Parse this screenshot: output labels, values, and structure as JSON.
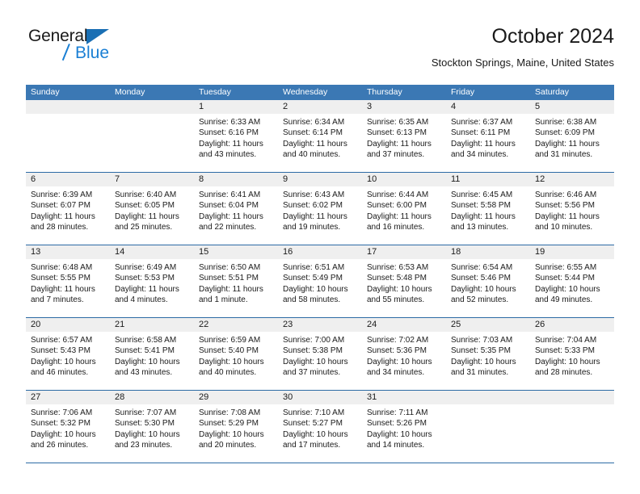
{
  "brand": {
    "name_part1": "General",
    "name_part2": "Blue"
  },
  "header": {
    "month_title": "October 2024",
    "location": "Stockton Springs, Maine, United States"
  },
  "colors": {
    "header_blue": "#3b78b4",
    "row_divider_blue": "#2c6ba5",
    "day_band_gray": "#efefef",
    "brand_blue": "#1a7fd4"
  },
  "weekdays": [
    "Sunday",
    "Monday",
    "Tuesday",
    "Wednesday",
    "Thursday",
    "Friday",
    "Saturday"
  ],
  "weeks": [
    [
      {
        "day": "",
        "empty": true
      },
      {
        "day": "",
        "empty": true
      },
      {
        "day": "1",
        "sunrise": "Sunrise: 6:33 AM",
        "sunset": "Sunset: 6:16 PM",
        "daylight_line1": "Daylight: 11 hours",
        "daylight_line2": "and 43 minutes."
      },
      {
        "day": "2",
        "sunrise": "Sunrise: 6:34 AM",
        "sunset": "Sunset: 6:14 PM",
        "daylight_line1": "Daylight: 11 hours",
        "daylight_line2": "and 40 minutes."
      },
      {
        "day": "3",
        "sunrise": "Sunrise: 6:35 AM",
        "sunset": "Sunset: 6:13 PM",
        "daylight_line1": "Daylight: 11 hours",
        "daylight_line2": "and 37 minutes."
      },
      {
        "day": "4",
        "sunrise": "Sunrise: 6:37 AM",
        "sunset": "Sunset: 6:11 PM",
        "daylight_line1": "Daylight: 11 hours",
        "daylight_line2": "and 34 minutes."
      },
      {
        "day": "5",
        "sunrise": "Sunrise: 6:38 AM",
        "sunset": "Sunset: 6:09 PM",
        "daylight_line1": "Daylight: 11 hours",
        "daylight_line2": "and 31 minutes."
      }
    ],
    [
      {
        "day": "6",
        "sunrise": "Sunrise: 6:39 AM",
        "sunset": "Sunset: 6:07 PM",
        "daylight_line1": "Daylight: 11 hours",
        "daylight_line2": "and 28 minutes."
      },
      {
        "day": "7",
        "sunrise": "Sunrise: 6:40 AM",
        "sunset": "Sunset: 6:05 PM",
        "daylight_line1": "Daylight: 11 hours",
        "daylight_line2": "and 25 minutes."
      },
      {
        "day": "8",
        "sunrise": "Sunrise: 6:41 AM",
        "sunset": "Sunset: 6:04 PM",
        "daylight_line1": "Daylight: 11 hours",
        "daylight_line2": "and 22 minutes."
      },
      {
        "day": "9",
        "sunrise": "Sunrise: 6:43 AM",
        "sunset": "Sunset: 6:02 PM",
        "daylight_line1": "Daylight: 11 hours",
        "daylight_line2": "and 19 minutes."
      },
      {
        "day": "10",
        "sunrise": "Sunrise: 6:44 AM",
        "sunset": "Sunset: 6:00 PM",
        "daylight_line1": "Daylight: 11 hours",
        "daylight_line2": "and 16 minutes."
      },
      {
        "day": "11",
        "sunrise": "Sunrise: 6:45 AM",
        "sunset": "Sunset: 5:58 PM",
        "daylight_line1": "Daylight: 11 hours",
        "daylight_line2": "and 13 minutes."
      },
      {
        "day": "12",
        "sunrise": "Sunrise: 6:46 AM",
        "sunset": "Sunset: 5:56 PM",
        "daylight_line1": "Daylight: 11 hours",
        "daylight_line2": "and 10 minutes."
      }
    ],
    [
      {
        "day": "13",
        "sunrise": "Sunrise: 6:48 AM",
        "sunset": "Sunset: 5:55 PM",
        "daylight_line1": "Daylight: 11 hours",
        "daylight_line2": "and 7 minutes."
      },
      {
        "day": "14",
        "sunrise": "Sunrise: 6:49 AM",
        "sunset": "Sunset: 5:53 PM",
        "daylight_line1": "Daylight: 11 hours",
        "daylight_line2": "and 4 minutes."
      },
      {
        "day": "15",
        "sunrise": "Sunrise: 6:50 AM",
        "sunset": "Sunset: 5:51 PM",
        "daylight_line1": "Daylight: 11 hours",
        "daylight_line2": "and 1 minute."
      },
      {
        "day": "16",
        "sunrise": "Sunrise: 6:51 AM",
        "sunset": "Sunset: 5:49 PM",
        "daylight_line1": "Daylight: 10 hours",
        "daylight_line2": "and 58 minutes."
      },
      {
        "day": "17",
        "sunrise": "Sunrise: 6:53 AM",
        "sunset": "Sunset: 5:48 PM",
        "daylight_line1": "Daylight: 10 hours",
        "daylight_line2": "and 55 minutes."
      },
      {
        "day": "18",
        "sunrise": "Sunrise: 6:54 AM",
        "sunset": "Sunset: 5:46 PM",
        "daylight_line1": "Daylight: 10 hours",
        "daylight_line2": "and 52 minutes."
      },
      {
        "day": "19",
        "sunrise": "Sunrise: 6:55 AM",
        "sunset": "Sunset: 5:44 PM",
        "daylight_line1": "Daylight: 10 hours",
        "daylight_line2": "and 49 minutes."
      }
    ],
    [
      {
        "day": "20",
        "sunrise": "Sunrise: 6:57 AM",
        "sunset": "Sunset: 5:43 PM",
        "daylight_line1": "Daylight: 10 hours",
        "daylight_line2": "and 46 minutes."
      },
      {
        "day": "21",
        "sunrise": "Sunrise: 6:58 AM",
        "sunset": "Sunset: 5:41 PM",
        "daylight_line1": "Daylight: 10 hours",
        "daylight_line2": "and 43 minutes."
      },
      {
        "day": "22",
        "sunrise": "Sunrise: 6:59 AM",
        "sunset": "Sunset: 5:40 PM",
        "daylight_line1": "Daylight: 10 hours",
        "daylight_line2": "and 40 minutes."
      },
      {
        "day": "23",
        "sunrise": "Sunrise: 7:00 AM",
        "sunset": "Sunset: 5:38 PM",
        "daylight_line1": "Daylight: 10 hours",
        "daylight_line2": "and 37 minutes."
      },
      {
        "day": "24",
        "sunrise": "Sunrise: 7:02 AM",
        "sunset": "Sunset: 5:36 PM",
        "daylight_line1": "Daylight: 10 hours",
        "daylight_line2": "and 34 minutes."
      },
      {
        "day": "25",
        "sunrise": "Sunrise: 7:03 AM",
        "sunset": "Sunset: 5:35 PM",
        "daylight_line1": "Daylight: 10 hours",
        "daylight_line2": "and 31 minutes."
      },
      {
        "day": "26",
        "sunrise": "Sunrise: 7:04 AM",
        "sunset": "Sunset: 5:33 PM",
        "daylight_line1": "Daylight: 10 hours",
        "daylight_line2": "and 28 minutes."
      }
    ],
    [
      {
        "day": "27",
        "sunrise": "Sunrise: 7:06 AM",
        "sunset": "Sunset: 5:32 PM",
        "daylight_line1": "Daylight: 10 hours",
        "daylight_line2": "and 26 minutes."
      },
      {
        "day": "28",
        "sunrise": "Sunrise: 7:07 AM",
        "sunset": "Sunset: 5:30 PM",
        "daylight_line1": "Daylight: 10 hours",
        "daylight_line2": "and 23 minutes."
      },
      {
        "day": "29",
        "sunrise": "Sunrise: 7:08 AM",
        "sunset": "Sunset: 5:29 PM",
        "daylight_line1": "Daylight: 10 hours",
        "daylight_line2": "and 20 minutes."
      },
      {
        "day": "30",
        "sunrise": "Sunrise: 7:10 AM",
        "sunset": "Sunset: 5:27 PM",
        "daylight_line1": "Daylight: 10 hours",
        "daylight_line2": "and 17 minutes."
      },
      {
        "day": "31",
        "sunrise": "Sunrise: 7:11 AM",
        "sunset": "Sunset: 5:26 PM",
        "daylight_line1": "Daylight: 10 hours",
        "daylight_line2": "and 14 minutes."
      },
      {
        "day": "",
        "empty": true
      },
      {
        "day": "",
        "empty": true
      }
    ]
  ]
}
